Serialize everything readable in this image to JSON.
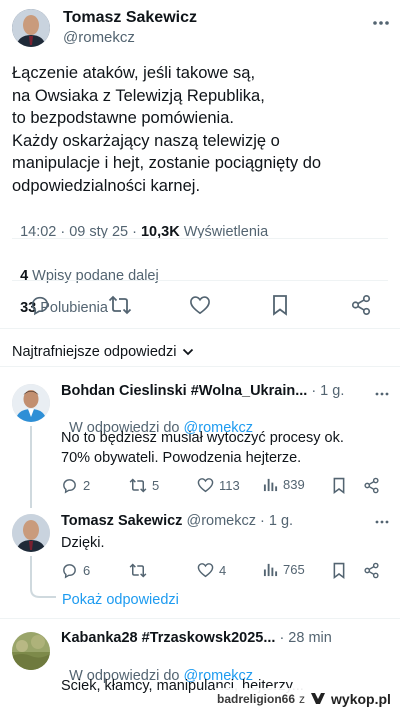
{
  "tweet": {
    "author_name": "Tomasz Sakewicz",
    "author_handle": "@romekcz",
    "text_lines": [
      "Łączenie ataków, jeśli takowe są,",
      "na Owsiaka z Telewizją Republika,",
      "to bezpodstawne pomówienia.",
      "Każdy oskarżający naszą telewizję o",
      "manipulacje i hejt, zostanie pociągnięty do",
      "odpowiedzialności karnej."
    ],
    "timestamp": "14:02 · 09 sty 25 · ",
    "views_count": "10,3K",
    "views_label": " Wyświetlenia",
    "reposts_count": "4",
    "reposts_label": "Wpisy podane dalej",
    "likes_count": "33",
    "likes_label": "Polubienia"
  },
  "actions": [
    "reply-icon",
    "repost-icon",
    "like-icon",
    "bookmark-icon",
    "share-icon"
  ],
  "replies_sort_label": "Najtrafniejsze odpowiedzi",
  "replies": [
    {
      "name": "Bohdan Cieslinski #Wolna_Ukrain...",
      "time": "· 1 g.",
      "reply_to_prefix": "W odpowiedzi do ",
      "reply_to_handle": "@romekcz",
      "text_lines": [
        "No to będziesz musiał wytoczyć procesy ok.",
        "70% obywateli. Powodzenia hejterze."
      ],
      "reply_count": "2",
      "repost_count": "5",
      "like_count": "113",
      "view_count": "839"
    },
    {
      "name": "Tomasz Sakewicz",
      "handle": "@romekcz",
      "time": "· 1 g.",
      "text_lines": [
        "Dzięki."
      ],
      "reply_count": "6",
      "repost_count": "",
      "like_count": "4",
      "view_count": "765",
      "show_replies_label": "Pokaż odpowiedzi"
    },
    {
      "name": "Kabanka28 #Trzaskowsk2025...",
      "time": "· 28 min",
      "reply_to_prefix": "W odpowiedzi do ",
      "reply_to_handle": "@romekcz",
      "text_lines": [
        "Sciek, kłamcy, manipulanci, hejterzy..."
      ]
    }
  ],
  "watermark": {
    "user": "badreligion66",
    "connector": "z",
    "site": "wykop.pl"
  },
  "colors": {
    "text": "#0f1419",
    "muted": "#536471",
    "link": "#1d9bf0",
    "divider": "#eff3f4"
  }
}
